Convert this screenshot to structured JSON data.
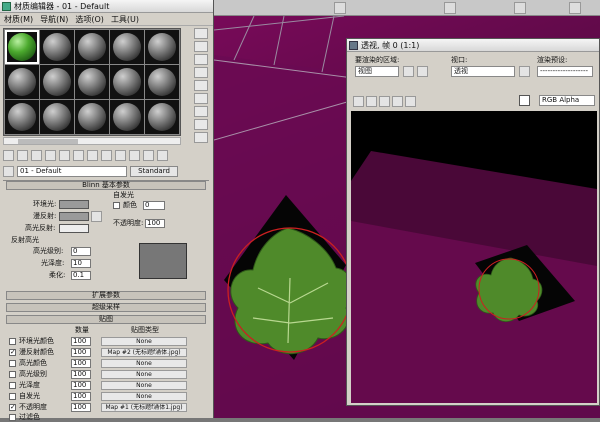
{
  "material_editor": {
    "title": "材质编辑器 - 01 - Default",
    "menu": [
      "材质(M)",
      "导航(N)",
      "选项(O)",
      "工具(U)"
    ],
    "material_name": "01 - Default",
    "material_type": "Standard",
    "basic_params_header": "Blinn 基本参数",
    "self_illum": {
      "title": "自发光",
      "color_label": "颜色",
      "value": "0"
    },
    "ambient_label": "环境光:",
    "diffuse_label": "漫反射:",
    "specular_label": "高光反射:",
    "opacity_label": "不透明度:",
    "opacity_value": "100",
    "specular_highlights": {
      "title": "反射高光",
      "level_label": "高光级别:",
      "level_value": "0",
      "gloss_label": "光泽度:",
      "gloss_value": "10",
      "soften_label": "柔化:",
      "soften_value": "0.1"
    },
    "rollouts": {
      "extended": "扩展参数",
      "supersampling": "超级采样",
      "maps": "贴图"
    },
    "maps_headers": {
      "amount": "数量",
      "map_type": "贴图类型"
    },
    "maps": [
      {
        "label": "环境光颜色",
        "amount": "100",
        "map": "None",
        "checked": false
      },
      {
        "label": "漫反射颜色",
        "amount": "100",
        "map": "Map #2 (无标题f涌体.jpg)",
        "checked": true
      },
      {
        "label": "高光颜色",
        "amount": "100",
        "map": "None",
        "checked": false
      },
      {
        "label": "高光级别",
        "amount": "100",
        "map": "None",
        "checked": false
      },
      {
        "label": "光泽度",
        "amount": "100",
        "map": "None",
        "checked": false
      },
      {
        "label": "自发光",
        "amount": "100",
        "map": "None",
        "checked": false
      },
      {
        "label": "不透明度",
        "amount": "100",
        "map": "Map #1 (无标题f涌体1.jpg)",
        "checked": true
      },
      {
        "label": "过滤色",
        "amount": "100",
        "map": "None",
        "checked": false
      }
    ]
  },
  "render_frame": {
    "title": "透视, 帧 0 (1:1)",
    "area_label": "要渲染的区域:",
    "area_value": "视图",
    "viewport_label": "视口:",
    "viewport_value": "透视",
    "preset_label": "渲染预设:",
    "preset_value": "-------------------",
    "channel_value": "RGB Alpha",
    "colors": {
      "red": "#d01010",
      "green": "#109010",
      "blue": "#1020c0"
    }
  },
  "accent": {
    "leaf_green": "#4f8a2a",
    "viewport_magenta": "#6a0a50",
    "circle_red": "#cc2020"
  }
}
